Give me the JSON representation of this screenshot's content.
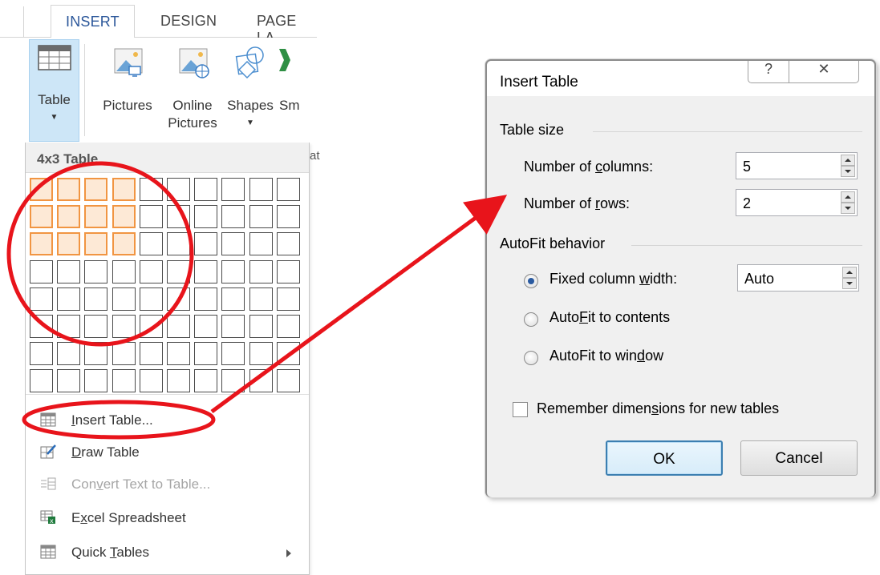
{
  "ribbon": {
    "tabs": [
      {
        "label": "INSERT",
        "active": true
      },
      {
        "label": "DESIGN",
        "active": false
      },
      {
        "label": "PAGE LA",
        "active": false
      }
    ],
    "table_button": {
      "label": "Table",
      "icon": "table-grid-icon"
    },
    "pictures_button": {
      "label": "Pictures",
      "icon": "picture-icon"
    },
    "online_pictures_button": {
      "line1": "Online",
      "line2": "Pictures",
      "icon": "online-picture-icon"
    },
    "shapes_button": {
      "label": "Shapes",
      "icon": "shapes-icon"
    },
    "smartart_button": {
      "label": "Sm",
      "icon": "smartart-icon"
    },
    "partial_label": "at"
  },
  "table_menu": {
    "header": "4x3 Table",
    "grid": {
      "columns": 10,
      "rows": 8,
      "selected_columns": 4,
      "selected_rows": 3
    },
    "items": [
      {
        "label": "Insert Table...",
        "mnemonic_index": 0,
        "icon": "insert-table-icon",
        "enabled": true,
        "submenu": false
      },
      {
        "label": "Draw Table",
        "mnemonic_index": 0,
        "icon": "draw-table-icon",
        "enabled": true,
        "submenu": false
      },
      {
        "label": "Convert Text to Table...",
        "mnemonic_index": 3,
        "icon": "convert-text-icon",
        "enabled": false,
        "submenu": false
      },
      {
        "label": "Excel Spreadsheet",
        "mnemonic_index": 1,
        "icon": "excel-spreadsheet-icon",
        "enabled": true,
        "submenu": false
      },
      {
        "label": "Quick Tables",
        "mnemonic_index": 6,
        "icon": "quick-tables-icon",
        "enabled": true,
        "submenu": true
      }
    ]
  },
  "dialog": {
    "title": "Insert Table",
    "help_glyph": "?",
    "close_glyph": "✕",
    "table_size": {
      "label": "Table size",
      "columns": {
        "pre": "Number of ",
        "key": "c",
        "post": "olumns:",
        "value": "5"
      },
      "rows": {
        "pre": "Number of ",
        "key": "r",
        "post": "ows:",
        "value": "2"
      }
    },
    "autofit": {
      "label": "AutoFit behavior",
      "fixed": {
        "pre": "Fixed column ",
        "key": "w",
        "post": "idth:",
        "value": "Auto",
        "selected": true
      },
      "contents": {
        "pre": "Auto",
        "key": "F",
        "post": "it to contents",
        "selected": false
      },
      "window": {
        "pre": "AutoFit to win",
        "key": "d",
        "post": "ow",
        "selected": false
      }
    },
    "remember": {
      "pre": "Remember dimen",
      "key": "s",
      "post": "ions for new tables",
      "checked": false
    },
    "ok_label": "OK",
    "cancel_label": "Cancel"
  },
  "annotation": {
    "color": "#e8141b"
  }
}
